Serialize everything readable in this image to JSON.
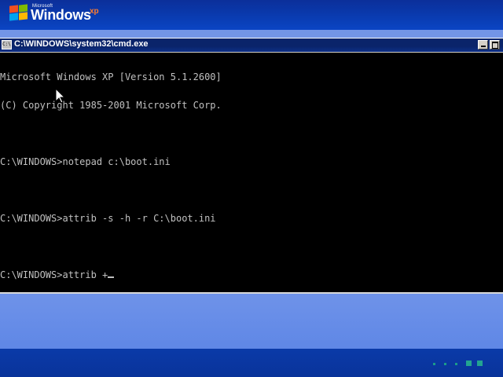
{
  "branding": {
    "company_small": "Microsoft",
    "product": "Windows",
    "edition": "xp"
  },
  "window": {
    "title": "C:\\WINDOWS\\system32\\cmd.exe",
    "icon_text": "C:\\"
  },
  "console": {
    "lines": [
      "Microsoft Windows XP [Version 5.1.2600]",
      "(C) Copyright 1985-2001 Microsoft Corp.",
      "",
      "C:\\WINDOWS>notepad c:\\boot.ini",
      "",
      "C:\\WINDOWS>attrib -s -h -r C:\\boot.ini",
      "",
      "C:\\WINDOWS>attrib +"
    ]
  },
  "colors": {
    "console_bg": "#000000",
    "console_fg": "#c0c0c0",
    "titlebar": "#0a246a",
    "background": "#7395e6"
  },
  "icons": [
    "windows-flag-icon",
    "cmd-icon",
    "minimize-icon",
    "maximize-icon",
    "mouse-pointer-icon",
    "progress-indicator"
  ]
}
